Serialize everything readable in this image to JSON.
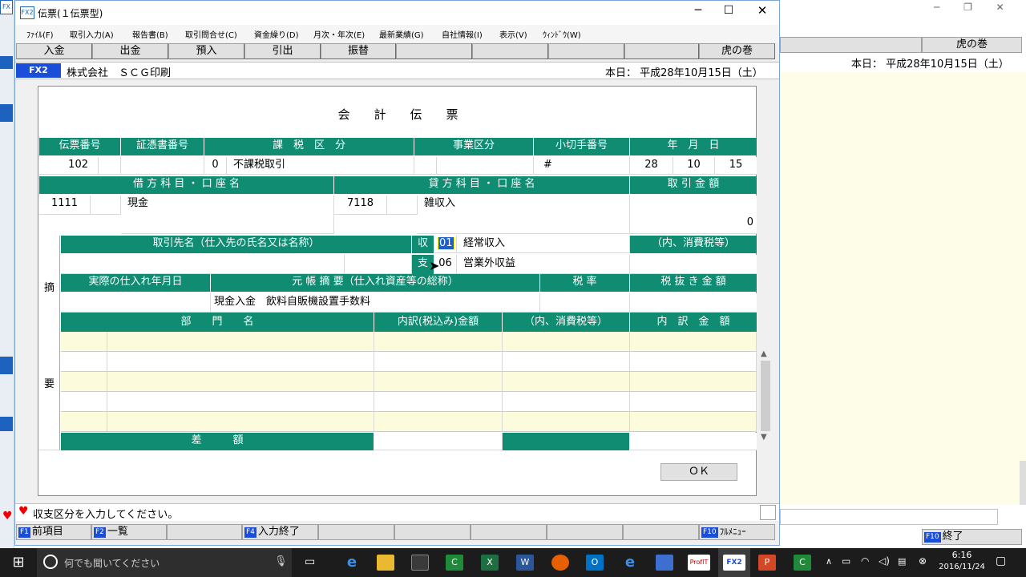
{
  "bg": {
    "top_label": "虎の巻",
    "today": "本日： 平成28年10月15日（土） ",
    "end_key": "F10",
    "end_label": "終了"
  },
  "window": {
    "app_icon": "FX2",
    "title": "伝票(１伝票型)"
  },
  "menu": [
    "ﾌｧｲﾙ(F)",
    "取引入力(A)",
    "報告書(B)",
    "取引問合せ(C)",
    "資金繰り(D)",
    "月次・年次(E)",
    "最新業績(G)",
    "自社情報(I)",
    "表示(V)",
    "ｳｨﾝﾄﾞｳ(W)"
  ],
  "toolbar": {
    "nyukin": "入金",
    "shukkin": "出金",
    "azukeire": "預入",
    "hikidashi": "引出",
    "furikae": "振替",
    "toranomaki": "虎の巻"
  },
  "info": {
    "badge": "FX2",
    "company": "株式会社　ＳＣＧ印刷",
    "today": "本日： 平成28年10月15日（土）"
  },
  "form": {
    "title": "会　　計　　伝　　票",
    "h_denpyo_no": "伝票番号",
    "h_shohyo_no": "証憑書番号",
    "h_kazei_kubun": "課　税　区　分",
    "h_jigyo_kubun": "事業区分",
    "h_kogitte_no": "小切手番号",
    "h_ymd": "年　月　日",
    "denpyo_no": "102",
    "kazei_code": "0",
    "kazei_name": "不課税取引",
    "kogitte_mark": "#",
    "year": "28",
    "month": "10",
    "day": "15",
    "h_debit": "借 方 科 目 ・ 口 座 名",
    "h_credit": "貸 方 科 目 ・ 口 座 名",
    "h_amount": "取 引 金 額",
    "debit_code": "1111",
    "debit_name": "現金",
    "credit_code": "7118",
    "credit_name": "雑収入",
    "amount": "0",
    "tekiyo_1": "摘",
    "tekiyo_2": "要",
    "h_torihikisaki": "取引先名（仕入先の氏名又は名称）",
    "shu_label": "収",
    "shu_code": "01",
    "shu_name": "経常収入",
    "shi_label": "支",
    "shi_code": "06",
    "shi_name": "営業外収益",
    "h_uchi_tax": "（内、消費税等）",
    "h_shiire_date": "実際の仕入れ年月日",
    "h_motocho_tekiyo": "元 帳 摘 要（仕入れ資産等の総称）",
    "h_zeiritsu": "税 率",
    "h_zeinuki": "税 抜 き 金 額",
    "tekiyo_text": "現金入金　飲料自販機設置手数料",
    "h_bumon": "部　　門　　名",
    "h_uchiwake_zeikomi": "内訳(税込み)金額",
    "h_uchi_tax2": "（内、消費税等）",
    "h_uchiwake_kingaku": "内　訳　金　額",
    "sagaku": "差　　　額",
    "ok": "ＯＫ"
  },
  "status": {
    "message": "収支区分を入力してください。"
  },
  "fkeys": {
    "f1_key": "F1",
    "f1_label": "前項目",
    "f2_key": "F2",
    "f2_label": "一覧",
    "f4_key": "F4",
    "f4_label": "入力終了",
    "f10_key": "F10",
    "f10_label": "ﾌﾙﾒﾆｭｰ"
  },
  "taskbar": {
    "search_placeholder": "何でも聞いてください",
    "time": "6:16",
    "date": "2016/11/24",
    "apps": [
      "e",
      "",
      "",
      "C",
      "X",
      "W",
      "",
      "O",
      "e",
      "",
      "ProfIT",
      "FX2",
      "P",
      "C"
    ]
  }
}
